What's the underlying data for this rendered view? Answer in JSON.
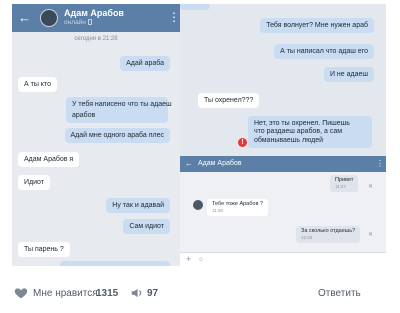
{
  "left_chat": {
    "contact_name": "Адам Арабов",
    "status": "онлайн",
    "date_divider": "сегодня в 21:28",
    "messages": [
      {
        "dir": "out",
        "text": "Адай араба"
      },
      {
        "dir": "in",
        "text": "А ты кто"
      },
      {
        "dir": "out",
        "text": "У тебя написено что ты адаеш"
      },
      {
        "dir": "out",
        "text": "арабов"
      },
      {
        "dir": "out",
        "text": "Адай мне одного араба плес"
      },
      {
        "dir": "in",
        "text": "Адам Арабов  я"
      },
      {
        "dir": "in",
        "text": "Идиот"
      },
      {
        "dir": "out",
        "text": "Ну так и адавай"
      },
      {
        "dir": "out",
        "text": "Сам идиот"
      },
      {
        "dir": "in",
        "text": "Ты парень ?"
      }
    ]
  },
  "right_chat": {
    "messages": [
      {
        "dir": "out",
        "text": "Тебя волнует? Мне нужен араб"
      },
      {
        "dir": "out",
        "text": "А ты написал что адаш его"
      },
      {
        "dir": "out",
        "text": "И не адаеш"
      },
      {
        "dir": "in",
        "text": "Ты охренел???"
      },
      {
        "dir": "out",
        "text": "Нет, это ты охренел. Пишешь"
      },
      {
        "dir": "out",
        "text": "что раздаеш арабов, а сам"
      },
      {
        "dir": "out",
        "text": "обманываешь людей"
      }
    ]
  },
  "inset_chat": {
    "contact_name": "Адам Арабов",
    "messages": [
      {
        "dir": "out",
        "text": "Привет",
        "time": "11:27"
      },
      {
        "dir": "in",
        "text": "Тебе тоже Арабов ?",
        "time": "11:28"
      },
      {
        "dir": "out",
        "text": "За сколько отдаешь?",
        "time": "12:26"
      }
    ],
    "compose_placeholder": "+"
  },
  "footer": {
    "like_label": "Мне нравится",
    "like_count": "1315",
    "share_count": "97",
    "reply_label": "Ответить"
  },
  "colors": {
    "vk_header": "#5b7fa6",
    "out_bubble": "#c9dcf2",
    "chat_background": "#e7ebf0",
    "error": "#e03b3b"
  }
}
